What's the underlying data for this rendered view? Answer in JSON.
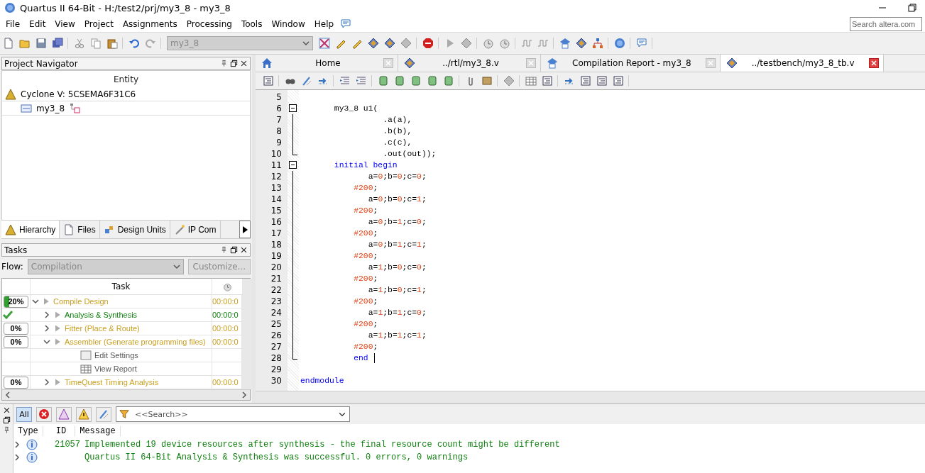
{
  "window": {
    "title": "Quartus II 64-Bit - H:/test2/prj/my3_8 - my3_8"
  },
  "menu": [
    "File",
    "Edit",
    "View",
    "Project",
    "Assignments",
    "Processing",
    "Tools",
    "Window",
    "Help"
  ],
  "search": {
    "placeholder": "Search altera.com"
  },
  "toolbar": {
    "project_combo": {
      "value": "my3_8",
      "disabled": true
    }
  },
  "project_navigator": {
    "title": "Project Navigator",
    "column": "Entity",
    "tree": [
      {
        "kind": "device",
        "label": "Cyclone V: 5CSEMA6F31C6",
        "children": [
          {
            "kind": "entity",
            "label": "my3_8"
          }
        ]
      }
    ],
    "tabs": [
      {
        "label": "Hierarchy",
        "selected": true
      },
      {
        "label": "Files",
        "selected": false
      },
      {
        "label": "Design Units",
        "selected": false
      },
      {
        "label": "IP Com",
        "selected": false
      }
    ]
  },
  "tasks": {
    "title": "Tasks",
    "flow_label": "Flow:",
    "flow": {
      "value": "Compilation",
      "disabled": true
    },
    "customize": {
      "label": "Customize...",
      "disabled": true
    },
    "column": "Task",
    "rows": [
      {
        "progress": {
          "kind": "percent",
          "text": "20%",
          "level": 0.2
        },
        "name": "Compile Design",
        "time": "00:00:0",
        "color": "#c8a020",
        "expanded": true,
        "children": [
          {
            "progress": {
              "kind": "done"
            },
            "name": "Analysis & Synthesis",
            "time": "00:00:0",
            "color": "#108010",
            "expanded": false
          },
          {
            "progress": {
              "kind": "percent",
              "text": "0%",
              "level": 0
            },
            "name": "Fitter (Place & Route)",
            "time": "00:00:0",
            "color": "#c8a020",
            "expanded": false
          },
          {
            "progress": {
              "kind": "percent",
              "text": "0%",
              "level": 0
            },
            "name": "Assembler (Generate programming files)",
            "time": "00:00:0",
            "color": "#c8a020",
            "expanded": true,
            "children": [
              {
                "kind": "settings",
                "name": "Edit Settings"
              },
              {
                "kind": "report",
                "name": "View Report"
              }
            ]
          },
          {
            "progress": {
              "kind": "percent",
              "text": "0%",
              "level": 0
            },
            "name": "TimeQuest Timing Analysis",
            "time": "00:00:0",
            "color": "#c8a020",
            "expanded": false
          }
        ]
      }
    ]
  },
  "editor": {
    "tabs": [
      {
        "label": "Home",
        "selected": false
      },
      {
        "label": "../rtl/my3_8.v",
        "selected": false
      },
      {
        "label": "Compilation Report - my3_8",
        "selected": false
      },
      {
        "label": "../testbench/my3_8_tb.v",
        "selected": true
      }
    ],
    "lines": [
      {
        "n": "5",
        "kind": "plain"
      },
      {
        "n": "6",
        "kind": "fold_start",
        "code": [
          {
            "t": "       my3_8 u1(",
            "kind": "plain"
          }
        ]
      },
      {
        "n": "7",
        "kind": "fold_body",
        "code": [
          {
            "t": "                 .a(a),",
            "kind": "plain"
          }
        ]
      },
      {
        "n": "8",
        "kind": "fold_body",
        "code": [
          {
            "t": "                 .b(b),",
            "kind": "plain"
          }
        ]
      },
      {
        "n": "9",
        "kind": "fold_body",
        "code": [
          {
            "t": "                 .c(c),",
            "kind": "plain"
          }
        ]
      },
      {
        "n": "10",
        "kind": "fold_end",
        "code": [
          {
            "t": "                 .out(out));",
            "kind": "plain"
          }
        ]
      },
      {
        "n": "11",
        "kind": "fold_start",
        "code": [
          {
            "t": "       initial begin",
            "kind": "keyword"
          }
        ]
      },
      {
        "n": "12",
        "kind": "fold_body",
        "code": [
          {
            "t": "              a=",
            "kind": "plain"
          },
          {
            "t": "0",
            "kind": "number"
          },
          {
            "t": ";b=",
            "kind": "plain"
          },
          {
            "t": "0",
            "kind": "number"
          },
          {
            "t": ";c=",
            "kind": "plain"
          },
          {
            "t": "0",
            "kind": "number"
          },
          {
            "t": ";",
            "kind": "plain"
          }
        ]
      },
      {
        "n": "13",
        "kind": "fold_body",
        "code": [
          {
            "t": "           #200",
            "kind": "number"
          },
          {
            "t": ";",
            "kind": "plain"
          }
        ]
      },
      {
        "n": "14",
        "kind": "fold_body",
        "code": [
          {
            "t": "              a=",
            "kind": "plain"
          },
          {
            "t": "0",
            "kind": "number"
          },
          {
            "t": ";b=",
            "kind": "plain"
          },
          {
            "t": "0",
            "kind": "number"
          },
          {
            "t": ";c=",
            "kind": "plain"
          },
          {
            "t": "1",
            "kind": "number"
          },
          {
            "t": ";",
            "kind": "plain"
          }
        ]
      },
      {
        "n": "15",
        "kind": "fold_body",
        "code": [
          {
            "t": "           #200",
            "kind": "number"
          },
          {
            "t": ";",
            "kind": "plain"
          }
        ]
      },
      {
        "n": "16",
        "kind": "fold_body",
        "code": [
          {
            "t": "              a=",
            "kind": "plain"
          },
          {
            "t": "0",
            "kind": "number"
          },
          {
            "t": ";b=",
            "kind": "plain"
          },
          {
            "t": "1",
            "kind": "number"
          },
          {
            "t": ";c=",
            "kind": "plain"
          },
          {
            "t": "0",
            "kind": "number"
          },
          {
            "t": ";",
            "kind": "plain"
          }
        ]
      },
      {
        "n": "17",
        "kind": "fold_body",
        "code": [
          {
            "t": "           #200",
            "kind": "number"
          },
          {
            "t": ";",
            "kind": "plain"
          }
        ]
      },
      {
        "n": "18",
        "kind": "fold_body",
        "code": [
          {
            "t": "              a=",
            "kind": "plain"
          },
          {
            "t": "0",
            "kind": "number"
          },
          {
            "t": ";b=",
            "kind": "plain"
          },
          {
            "t": "1",
            "kind": "number"
          },
          {
            "t": ";c=",
            "kind": "plain"
          },
          {
            "t": "1",
            "kind": "number"
          },
          {
            "t": ";",
            "kind": "plain"
          }
        ]
      },
      {
        "n": "19",
        "kind": "fold_body",
        "code": [
          {
            "t": "           #200",
            "kind": "number"
          },
          {
            "t": ";",
            "kind": "plain"
          }
        ]
      },
      {
        "n": "20",
        "kind": "fold_body",
        "code": [
          {
            "t": "              a=",
            "kind": "plain"
          },
          {
            "t": "1",
            "kind": "number"
          },
          {
            "t": ";b=",
            "kind": "plain"
          },
          {
            "t": "0",
            "kind": "number"
          },
          {
            "t": ";c=",
            "kind": "plain"
          },
          {
            "t": "0",
            "kind": "number"
          },
          {
            "t": ";",
            "kind": "plain"
          }
        ]
      },
      {
        "n": "21",
        "kind": "fold_body",
        "code": [
          {
            "t": "           #200",
            "kind": "number"
          },
          {
            "t": ";",
            "kind": "plain"
          }
        ]
      },
      {
        "n": "22",
        "kind": "fold_body",
        "code": [
          {
            "t": "              a=",
            "kind": "plain"
          },
          {
            "t": "1",
            "kind": "number"
          },
          {
            "t": ";b=",
            "kind": "plain"
          },
          {
            "t": "0",
            "kind": "number"
          },
          {
            "t": ";c=",
            "kind": "plain"
          },
          {
            "t": "1",
            "kind": "number"
          },
          {
            "t": ";",
            "kind": "plain"
          }
        ]
      },
      {
        "n": "23",
        "kind": "fold_body",
        "code": [
          {
            "t": "           #200",
            "kind": "number"
          },
          {
            "t": ";",
            "kind": "plain"
          }
        ]
      },
      {
        "n": "24",
        "kind": "fold_body",
        "code": [
          {
            "t": "              a=",
            "kind": "plain"
          },
          {
            "t": "1",
            "kind": "number"
          },
          {
            "t": ";b=",
            "kind": "plain"
          },
          {
            "t": "1",
            "kind": "number"
          },
          {
            "t": ";c=",
            "kind": "plain"
          },
          {
            "t": "0",
            "kind": "number"
          },
          {
            "t": ";",
            "kind": "plain"
          }
        ]
      },
      {
        "n": "25",
        "kind": "fold_body",
        "code": [
          {
            "t": "           #200",
            "kind": "number"
          },
          {
            "t": ";",
            "kind": "plain"
          }
        ]
      },
      {
        "n": "26",
        "kind": "fold_body",
        "code": [
          {
            "t": "              a=",
            "kind": "plain"
          },
          {
            "t": "1",
            "kind": "number"
          },
          {
            "t": ";b=",
            "kind": "plain"
          },
          {
            "t": "1",
            "kind": "number"
          },
          {
            "t": ";c=",
            "kind": "plain"
          },
          {
            "t": "1",
            "kind": "number"
          },
          {
            "t": ";",
            "kind": "plain"
          }
        ]
      },
      {
        "n": "27",
        "kind": "fold_body",
        "code": [
          {
            "t": "           #200",
            "kind": "number"
          },
          {
            "t": ";",
            "kind": "plain"
          }
        ]
      },
      {
        "n": "28",
        "kind": "fold_end",
        "cursor": true,
        "code": [
          {
            "t": "           end",
            "kind": "keyword"
          }
        ]
      },
      {
        "n": "29",
        "kind": "plain"
      },
      {
        "n": "30",
        "kind": "plain",
        "code": [
          {
            "t": "endmodule",
            "kind": "keyword"
          }
        ]
      }
    ]
  },
  "messages": {
    "filters": [
      {
        "kind": "all",
        "label": "All",
        "selected": true
      },
      {
        "kind": "error",
        "selected": false
      },
      {
        "kind": "critical",
        "selected": false
      },
      {
        "kind": "warning",
        "selected": false
      },
      {
        "kind": "suppressed",
        "selected": false
      }
    ],
    "search": {
      "placeholder": "<<Search>>"
    },
    "columns": [
      "Type",
      "ID",
      "Message"
    ],
    "rows": [
      {
        "kind": "info",
        "expanded": false,
        "id": "21057",
        "message": "Implemented 19 device resources after synthesis - the final resource count might be different"
      },
      {
        "kind": "info",
        "expanded": false,
        "message": "Quartus II 64-Bit Analysis & Synthesis was successful. 0 errors, 0 warnings"
      }
    ]
  }
}
